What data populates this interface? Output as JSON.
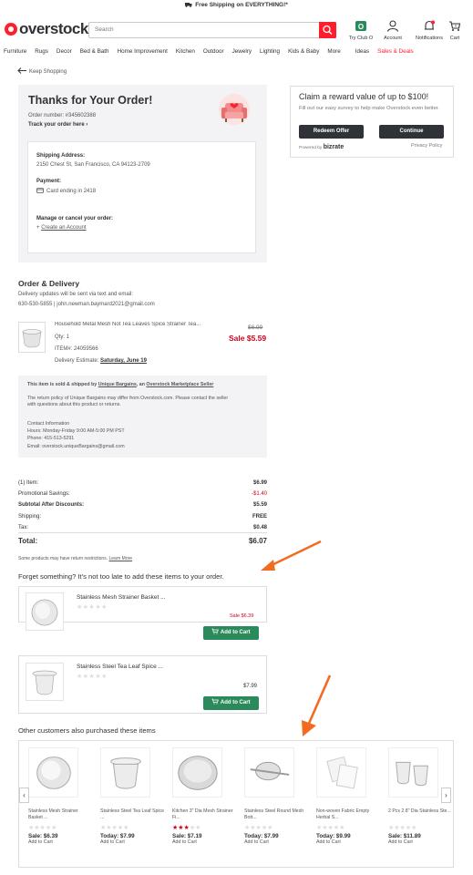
{
  "banner": {
    "text": "Free Shipping on EVERYTHING!*"
  },
  "header": {
    "logo": "overstock",
    "search_placeholder": "Search",
    "icons": [
      {
        "label": "Try Club O",
        "icon": "club-o-icon"
      },
      {
        "label": "Account",
        "icon": "account-icon"
      },
      {
        "label": "Notifications",
        "icon": "bell-icon"
      },
      {
        "label": "Cart",
        "icon": "cart-icon",
        "badge": "0"
      }
    ]
  },
  "nav": [
    "Furniture",
    "Rugs",
    "Decor",
    "Bed & Bath",
    "Home Improvement",
    "Kitchen",
    "Outdoor",
    "Jewelry",
    "Lighting",
    "Kids & Baby",
    "More",
    "Ideas",
    "Sales & Deals"
  ],
  "keep_shopping": "Keep Shopping",
  "order": {
    "title": "Thanks for Your Order!",
    "number": "Order number: #345602388",
    "track": "Track your order here",
    "shipping_label": "Shipping Address:",
    "shipping_value": "2150 Chest St, San Francisco, CA 94123-2709",
    "payment_label": "Payment:",
    "payment_value": "Card ending in 2418",
    "manage_label": "Manage or cancel your order:",
    "create_account": "Create an Account"
  },
  "reward": {
    "title": "Claim a reward value of up to $100!",
    "subtitle": "Fill out our easy survey to help make Overstock even better.",
    "redeem": "Redeem Offer",
    "continue": "Continue",
    "powered": "Powered by",
    "powered_brand": "bizrate",
    "privacy": "Privacy Policy"
  },
  "delivery": {
    "title": "Order & Delivery",
    "line1": "Delivery updates will be sent via text and email:",
    "line2": "630-530-5855 | john.newman.baymard2021@gmail.com",
    "product": {
      "name": "Household Metal Mesh Not Tea Leaves Spice Strainer Tea...",
      "qty": "Qty: 1",
      "item": "ITEM#: 24059566",
      "delivery_label": "Delivery Estimate:",
      "delivery_date": "Saturday, June 19",
      "orig_price": "$6.99",
      "sale_price": "Sale $5.59"
    },
    "seller": {
      "line1_a": "This item is sold & shipped by",
      "seller_name": "Unique Bargains",
      "line1_b": ", an",
      "marketplace": "Overstock Marketplace Seller",
      "policy1": "The return policy of Unique Bargains may differ from Overstock.com. Please contact the seller",
      "policy2": "with questions about this product or returns.",
      "contact_title": "Contact Information",
      "hours": "Hours: Monday-Friday 9:00 AM-5:00 PM PST",
      "phone": "Phone: 415-513-5291",
      "email": "Email: overstock.uniqueBargains@gmail.com"
    }
  },
  "totals": {
    "rows": [
      {
        "label": "(1) Item:",
        "value": "$6.99"
      },
      {
        "label": "Promotional Savings:",
        "value": "-$1.40"
      },
      {
        "label": "Subtotal After Discounts:",
        "value": "$5.59"
      },
      {
        "label": "Shipping:",
        "value": "FREE"
      },
      {
        "label": "Tax:",
        "value": "$0.48"
      }
    ],
    "total_label": "Total:",
    "total_value": "$6.07",
    "note": "Some products may have return restrictions.",
    "learn_more": "Learn More"
  },
  "forget": {
    "title": "Forget something? It's not too late to add these items to your order.",
    "items": [
      {
        "name": "Stainless Mesh Strainer Basket ...",
        "price": "Sale $6.39",
        "button": "Add to Cart"
      },
      {
        "name": "Stainless Steel Tea Leaf Spice ...",
        "price": "$7.99",
        "button": "Add to Cart"
      }
    ]
  },
  "others": {
    "title": "Other customers also purchased these items",
    "items": [
      {
        "name": "Stainless Mesh Strainer Basket ...",
        "price": "Sale: $6.39",
        "add": "Add to Cart",
        "rating": 0
      },
      {
        "name": "Stainless Steel Tea Leaf Spice ...",
        "price": "Today: $7.99",
        "add": "Add to Cart",
        "rating": 0
      },
      {
        "name": "Kitchen 3\" Dia Mesh Strainer Fi...",
        "price": "Sale: $7.19",
        "add": "Add to Cart",
        "rating": 3
      },
      {
        "name": "Stainless Steel Round Mesh Bott...",
        "price": "Today: $7.99",
        "add": "Add to Cart",
        "rating": 0
      },
      {
        "name": "Non-woven Fabric Empty Herbal S...",
        "price": "Today: $9.99",
        "add": "Add to Cart",
        "rating": 0
      },
      {
        "name": "2 Pcs 2.8\" Dia Stainless Ste...",
        "price": "Sale: $11.89",
        "add": "Add to Cart",
        "rating": 0
      }
    ]
  },
  "colors": {
    "brand_red": "#ff1f2c",
    "sale_red": "#d0021b",
    "cart_green": "#2a8a5b",
    "annotation_orange": "#f26b21"
  }
}
